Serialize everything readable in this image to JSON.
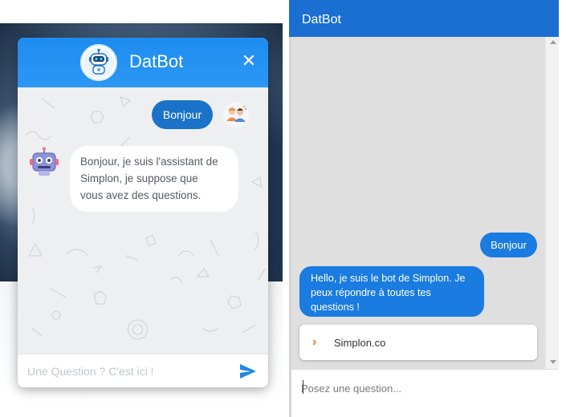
{
  "left_widget": {
    "title": "DatBot",
    "close_glyph": "✕",
    "messages": {
      "user": "Bonjour",
      "bot": [
        "Bonjour, je suis l'assistant de",
        "Simplon, je suppose que",
        "vous avez des questions."
      ]
    },
    "input_placeholder": "Une Question ? C'est ici !",
    "icons": [
      "robot-logo-icon",
      "close-icon",
      "user-avatar-icon",
      "bot-avatar-icon",
      "send-icon"
    ],
    "colors": {
      "header": "#1e8cf0",
      "user_bubble": "#1a73c9",
      "send": "#1e88e5"
    }
  },
  "right_panel": {
    "title": "DatBot",
    "messages": {
      "user": "Bonjour",
      "bot": [
        "Hello, je suis le bot de Simplon. Je",
        "peux répondre à toutes tes",
        "questions !"
      ]
    },
    "link_card": {
      "label": "Simplon.co",
      "icon": "chevron-right-icon"
    },
    "input_placeholder": "Posez une question...",
    "colors": {
      "header": "#1a6fd1",
      "bubble": "#1a7be0",
      "chevron": "#f07d1a"
    }
  }
}
